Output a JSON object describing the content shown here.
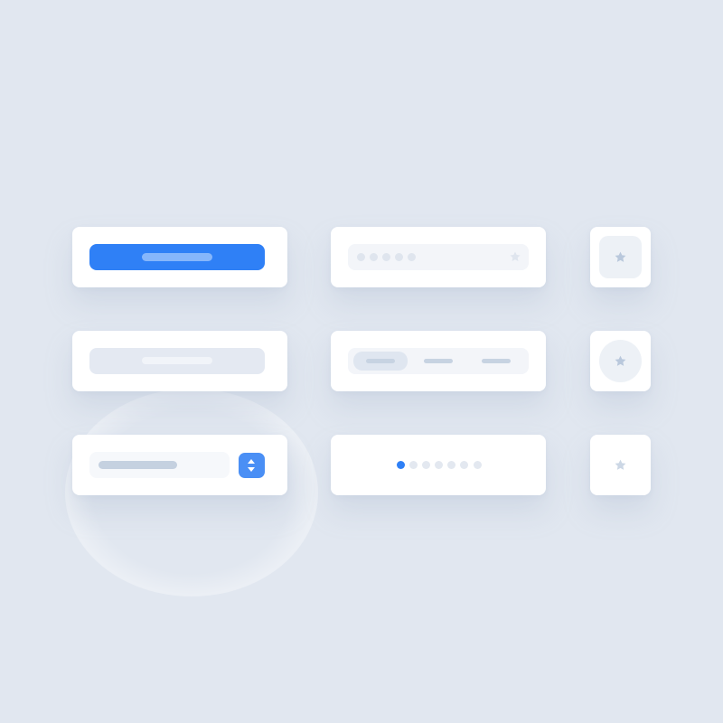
{
  "colors": {
    "background": "#e1e7f0",
    "accent": "#2f80f6",
    "card": "#ffffff"
  },
  "password_field": {
    "mask_dot_count": 5,
    "trailing_icon": "star-icon"
  },
  "segmented_control": {
    "segments": 3,
    "selected_index": 0
  },
  "page_indicator": {
    "total_pages": 7,
    "current_page": 1
  },
  "select": {
    "stepper_icon": "up-down-chevron-icon"
  },
  "icon_buttons": [
    {
      "variant": "rounded-square",
      "icon": "star-icon"
    },
    {
      "variant": "circle",
      "icon": "star-icon"
    },
    {
      "variant": "plain",
      "icon": "star-icon"
    }
  ]
}
